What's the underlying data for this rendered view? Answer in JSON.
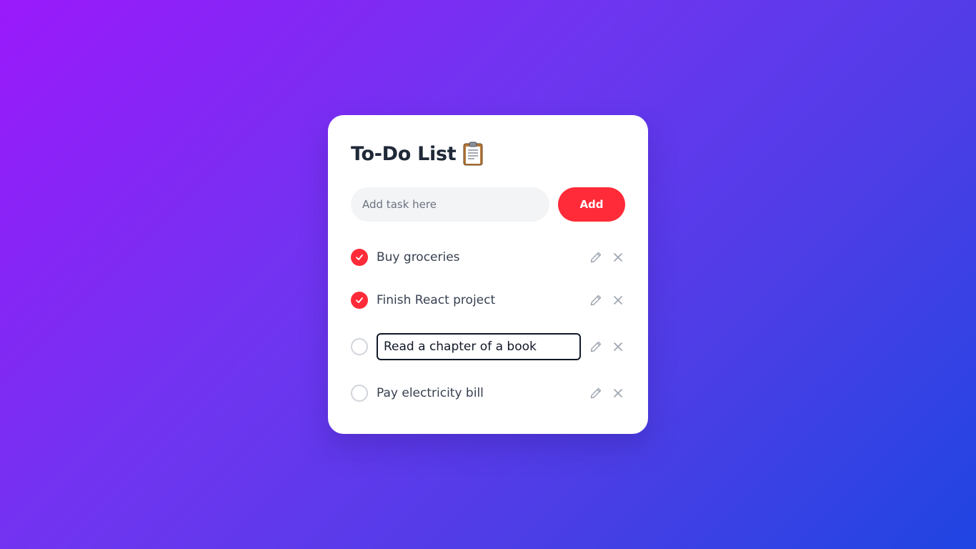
{
  "card": {
    "title": "To-Do List",
    "title_icon": "clipboard-icon"
  },
  "add_form": {
    "placeholder": "Add task here",
    "value": "",
    "button_label": "Add"
  },
  "tasks": [
    {
      "text": "Buy groceries",
      "completed": true,
      "editing": false
    },
    {
      "text": "Finish React project",
      "completed": true,
      "editing": false
    },
    {
      "text": "Read a chapter of a book",
      "completed": false,
      "editing": true
    },
    {
      "text": "Pay electricity bill",
      "completed": false,
      "editing": false
    }
  ],
  "icons": {
    "edit": "pencil-icon",
    "delete": "close-icon",
    "check": "checkmark-icon"
  },
  "colors": {
    "accent": "#ff2b39",
    "background_start": "#9a19fb",
    "background_end": "#1f45e2",
    "text": "#374151",
    "icon": "#9ca3af"
  }
}
